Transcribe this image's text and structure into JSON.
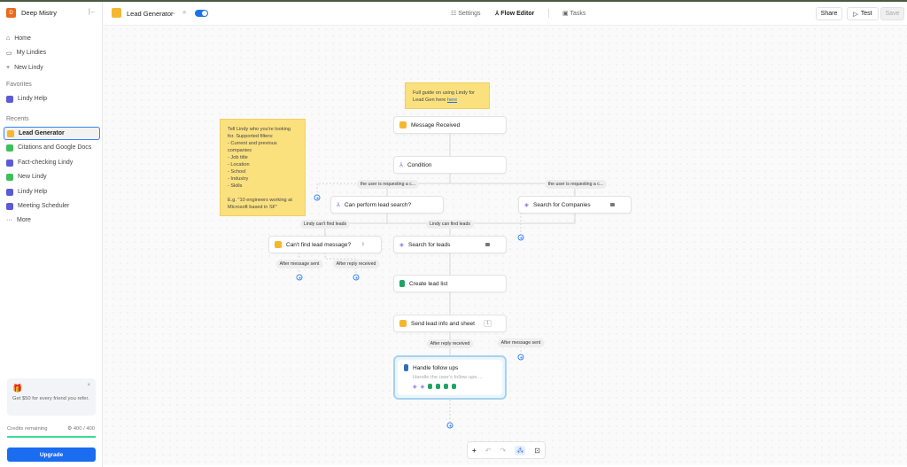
{
  "sidebar": {
    "user_initial": "D",
    "user_name": "Deep Mistry",
    "nav": [
      {
        "label": "Home"
      },
      {
        "label": "My Lindies"
      },
      {
        "label": "New Lindy"
      }
    ],
    "favorites_title": "Favorites",
    "favorites": [
      {
        "label": "Lindy Help",
        "color": "#5b5bd6"
      }
    ],
    "recents_title": "Recents",
    "recents": [
      {
        "label": "Lead Generator",
        "color": "#f5b731",
        "active": true
      },
      {
        "label": "Citations and Google Docs",
        "color": "#3fbf5a"
      },
      {
        "label": "Fact-checking Lindy",
        "color": "#5b5bd6"
      },
      {
        "label": "New Lindy",
        "color": "#3fbf5a"
      },
      {
        "label": "Lindy Help",
        "color": "#5b5bd6"
      },
      {
        "label": "Meeting Scheduler",
        "color": "#5b5bd6"
      }
    ],
    "more_label": "More",
    "promo_text": "Get $50 for every friend you refer.",
    "credits_label": "Credits remaining",
    "credits_value": "400 / 400",
    "credits_fraction": 1.0,
    "upgrade_label": "Upgrade"
  },
  "header": {
    "agent_name": "Lead Generator",
    "toggle_on": true,
    "tabs": [
      {
        "label": "Settings"
      },
      {
        "label": "Flow Editor",
        "active": true
      },
      {
        "label": "Tasks"
      }
    ],
    "share_label": "Share",
    "test_label": "Test",
    "save_label": "Save"
  },
  "canvas": {
    "sticky_guide": "Full guide on using Lindy for Lead Gen here ",
    "sticky_guide_link": "here",
    "sticky_filters": "Tell Lindy who you're looking for. Supported filters:\n- Current and previous companies\n- Job title\n- Location\n- School\n- Industry\n- Skills\n\nE.g. \"10 engineers working at Microsoft based in SF\"",
    "nodes": {
      "message_received": "Message Received",
      "condition": "Condition",
      "can_perform": "Can perform lead search?",
      "search_companies": "Search for Companies",
      "cant_find": "Can't find lead message?",
      "search_leads": "Search for leads",
      "create_list": "Create lead list",
      "send_info": "Send lead info and sheet",
      "send_info_badge": "1",
      "followups": "Handle follow ups",
      "followups_desc": "Handle the user's follow ups...."
    },
    "labels": {
      "branch_left": "the user is requesting a c...",
      "branch_right": "the user is requesting a c...",
      "cant_find": "Lindy can't find leads",
      "can_find": "Lindy can find leads",
      "after_msg_1": "After message sent",
      "after_reply_1": "After reply received",
      "after_reply_2": "After reply received",
      "after_msg_2": "After message sent"
    }
  },
  "colors": {
    "accent": "#1a73e8",
    "sticky": "#fbe07e",
    "upgrade": "#1a6cf0"
  }
}
